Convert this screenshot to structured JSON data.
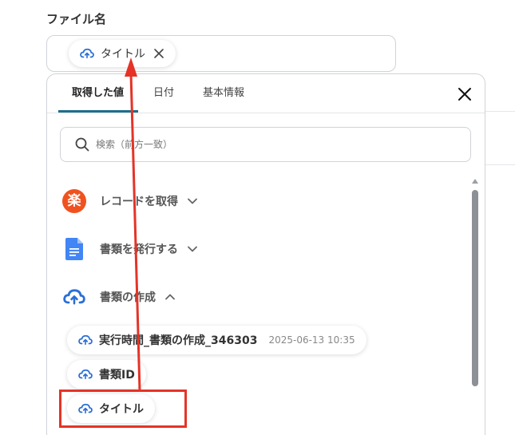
{
  "field": {
    "label": "ファイル名",
    "selected_chip": "タイトル"
  },
  "panel": {
    "tabs": [
      {
        "label": "取得した値",
        "active": true
      },
      {
        "label": "日付",
        "active": false
      },
      {
        "label": "基本情報",
        "active": false
      }
    ],
    "search_placeholder": "検索（前方一致）",
    "sections": [
      {
        "label": "レコードを取得",
        "expanded": false,
        "icon": "rakuten-icon"
      },
      {
        "label": "書類を発行する",
        "expanded": false,
        "icon": "google-docs-icon"
      },
      {
        "label": "書類の作成",
        "expanded": true,
        "icon": "cloud-icon"
      }
    ],
    "items": [
      {
        "label": "実行時間_書類の作成_346303",
        "date": "2025-06-13 10:35"
      },
      {
        "label": "書類ID"
      },
      {
        "label": "タイトル"
      }
    ]
  },
  "icons": {
    "rakuten_glyph": "楽"
  },
  "colors": {
    "accent": "#1f6d8c",
    "cloud": "#2b6fd6",
    "rakuten": "#f0521f",
    "docs": "#4285f4",
    "annotation": "#e53327"
  }
}
